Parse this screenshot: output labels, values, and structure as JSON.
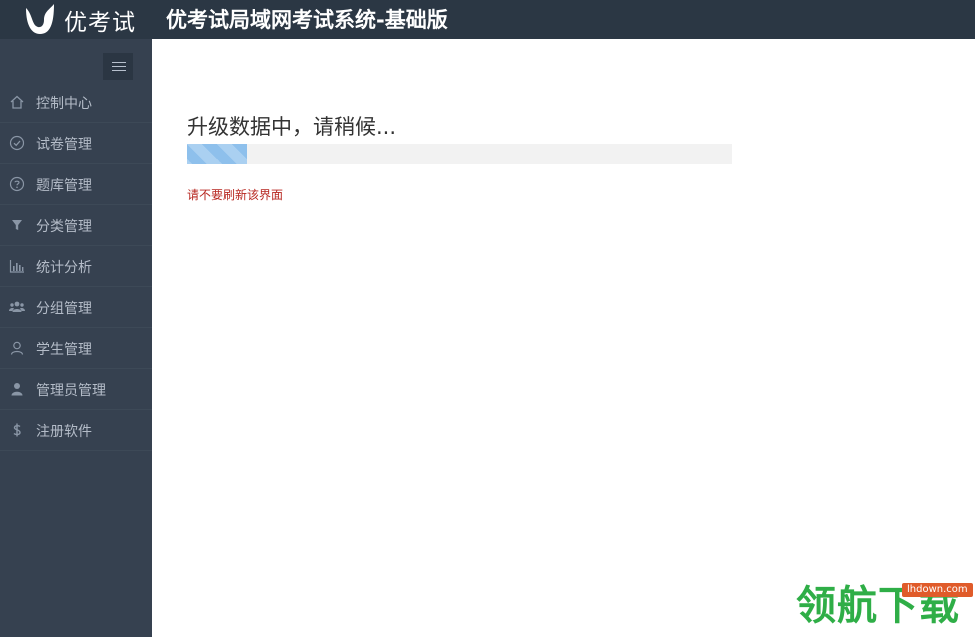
{
  "header": {
    "logo_text": "优考试",
    "app_title": "优考试局域网考试系统-基础版"
  },
  "sidebar": {
    "items": [
      {
        "label": "控制中心",
        "icon": "home-icon"
      },
      {
        "label": "试卷管理",
        "icon": "check-circle-icon"
      },
      {
        "label": "题库管理",
        "icon": "question-circle-icon"
      },
      {
        "label": "分类管理",
        "icon": "filter-icon"
      },
      {
        "label": "统计分析",
        "icon": "bar-chart-icon"
      },
      {
        "label": "分组管理",
        "icon": "users-icon"
      },
      {
        "label": "学生管理",
        "icon": "user-outline-icon"
      },
      {
        "label": "管理员管理",
        "icon": "user-icon"
      },
      {
        "label": "注册软件",
        "icon": "dollar-icon"
      }
    ]
  },
  "main": {
    "loading_title": "升级数据中，请稍候...",
    "progress_fraction": 0.11,
    "warning": "请不要刷新该界面"
  },
  "watermark": {
    "text": "领航下载",
    "badge": "lhdown.com"
  },
  "colors": {
    "topbar": "#2b3744",
    "sidebar": "#364150",
    "progress_fill": "#8ec0ec",
    "warning": "#b7261f",
    "watermark": "#2fae47"
  }
}
